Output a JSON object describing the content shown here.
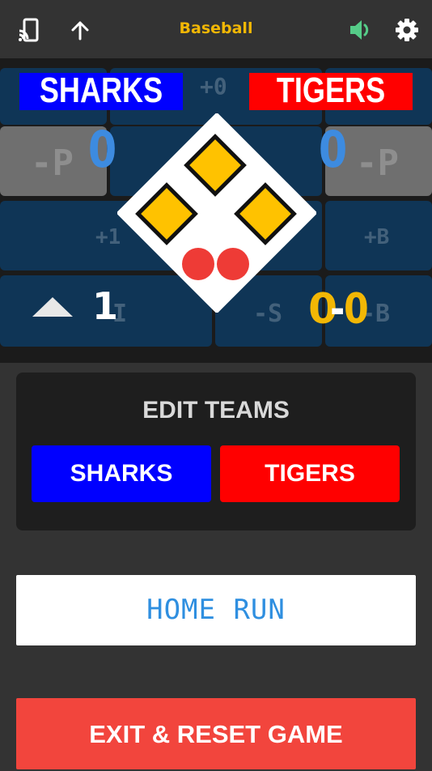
{
  "header": {
    "title": "Baseball",
    "icons": [
      "cast-icon",
      "upload-arrow-icon",
      "volume-icon",
      "gear-icon"
    ]
  },
  "scoreboard": {
    "home_team": "SHARKS",
    "home_color": "#0000FF",
    "away_team": "TIGERS",
    "away_color": "#FF0000",
    "home_score": "0",
    "away_score": "0",
    "inning_arrow": "up",
    "inning": "1",
    "balls": "0",
    "strikes": "0",
    "count_separator": "-",
    "outs_dots": 2,
    "bases_occupied": [
      "second",
      "third",
      "first"
    ],
    "ghost_labels": {
      "top_center": "+0",
      "left_p": "-P",
      "right_p": "-P",
      "plus_one": "+1",
      "plus_b": "+B",
      "bottom_i": "-I",
      "minus_s": "-S",
      "minus_b": "-B"
    }
  },
  "edit_teams": {
    "title": "EDIT TEAMS",
    "team1": "SHARKS",
    "team2": "TIGERS"
  },
  "actions": {
    "home_run": "HOME RUN",
    "exit_reset": "EXIT & RESET GAME"
  },
  "colors": {
    "accent_yellow": "#F2B705",
    "score_blue": "#3D8BE0",
    "exit_red": "#F2453D",
    "board_cell": "#0F3556",
    "base_yellow": "#FFC200",
    "out_red": "#EE3B36"
  }
}
